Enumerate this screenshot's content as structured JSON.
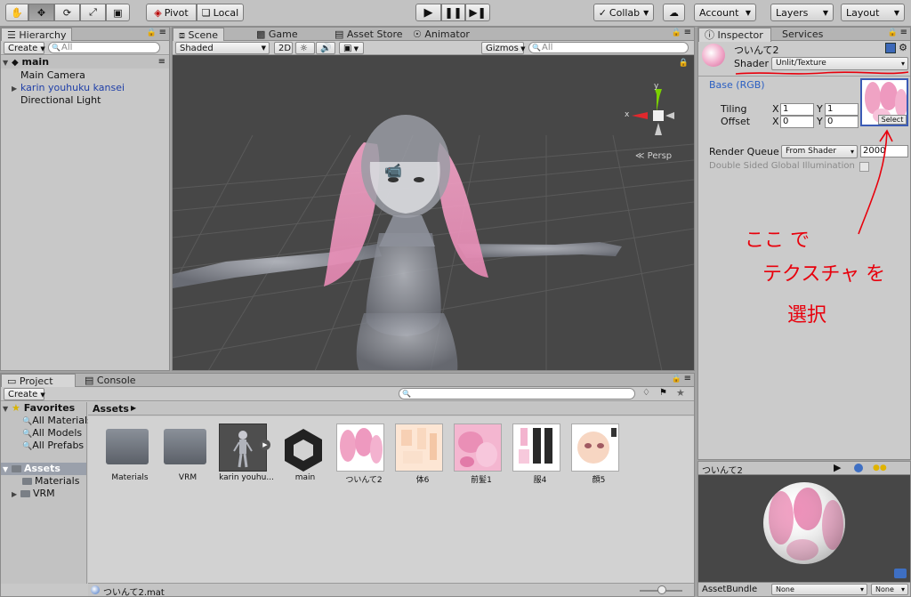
{
  "toolbar": {
    "tools": [
      "hand-icon",
      "move-icon",
      "rotate-icon",
      "scale-icon",
      "rect-icon"
    ],
    "pivot_label": "Pivot",
    "local_label": "Local",
    "play_icons": [
      "play-icon",
      "pause-icon",
      "step-icon"
    ],
    "collab_label": "Collab",
    "cloud_icon": "cloud-icon",
    "account_label": "Account",
    "layers_label": "Layers",
    "layout_label": "Layout"
  },
  "hierarchy": {
    "tab_label": "Hierarchy",
    "create_label": "Create",
    "search_placeholder": "All",
    "scene_name": "main",
    "items": [
      {
        "label": "Main Camera"
      },
      {
        "label": "karin youhuku kansei"
      },
      {
        "label": "Directional Light"
      }
    ]
  },
  "scene": {
    "tabs": [
      {
        "label": "Scene"
      },
      {
        "label": "Game"
      },
      {
        "label": "Asset Store"
      },
      {
        "label": "Animator"
      }
    ],
    "shading_mode": "Shaded",
    "mode_2d": "2D",
    "gizmos_label": "Gizmos",
    "search_placeholder": "All",
    "persp_label": "Persp",
    "gizmo_axes": {
      "y": "y",
      "x": "x"
    }
  },
  "inspector": {
    "tabs": [
      {
        "label": "Inspector"
      },
      {
        "label": "Services"
      }
    ],
    "material_name": "ついんて2",
    "shader_label": "Shader",
    "shader_value": "Unlit/Texture",
    "base_label": "Base (RGB)",
    "tiling_label": "Tiling",
    "offset_label": "Offset",
    "tiling_x": "1",
    "tiling_y": "1",
    "offset_x": "0",
    "offset_y": "0",
    "x_label": "X",
    "y_label": "Y",
    "select_label": "Select",
    "render_queue_label": "Render Queue",
    "render_queue_mode": "From Shader",
    "render_queue_value": "2000",
    "double_sided_label": "Double Sided Global Illumination",
    "annotation": [
      "ここ で",
      "テクスチャ を",
      "選択"
    ]
  },
  "preview": {
    "title": "ついんて2",
    "assetbundle_label": "AssetBundle",
    "assetbundle_value": "None",
    "assetbundle_variant": "None"
  },
  "project": {
    "tabs": [
      {
        "label": "Project"
      },
      {
        "label": "Console"
      }
    ],
    "create_label": "Create",
    "favorites_label": "Favorites",
    "favorites": [
      {
        "label": "All Materials"
      },
      {
        "label": "All Models"
      },
      {
        "label": "All Prefabs"
      }
    ],
    "assets_root": "Assets",
    "asset_folders": [
      {
        "label": "Materials"
      },
      {
        "label": "VRM"
      }
    ],
    "breadcrumb": "Assets",
    "assets": [
      {
        "label": "Materials",
        "kind": "folder"
      },
      {
        "label": "VRM",
        "kind": "folder"
      },
      {
        "label": "karin youhu...",
        "kind": "model"
      },
      {
        "label": "main",
        "kind": "unity"
      },
      {
        "label": "ついんて2",
        "kind": "tex-twin"
      },
      {
        "label": "体6",
        "kind": "tex-body"
      },
      {
        "label": "前髪1",
        "kind": "tex-bangs"
      },
      {
        "label": "服4",
        "kind": "tex-cloth"
      },
      {
        "label": "顔5",
        "kind": "tex-face"
      }
    ],
    "status_file": "ついんて2.mat"
  }
}
